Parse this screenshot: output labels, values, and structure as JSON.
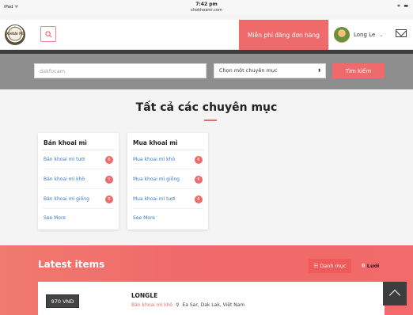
{
  "status_bar": {
    "device": "iPad ᯤ",
    "time": "7:42 pm",
    "url": "chokhoami.com",
    "indicators": "∗ ▬"
  },
  "header": {
    "logo_text": "KHOAI MÌ",
    "search_icon": "search-icon",
    "post_free_label": "Miễn phí đăng đơn hàng",
    "user_name": "Long Le",
    "caret": "⌄",
    "mail_icon": "mail-icon"
  },
  "search": {
    "keyword_value": "dakfocam",
    "category_select": "Chọn một chuyên mục",
    "select_arrow": "⬍",
    "submit_label": "Tìm kiếm"
  },
  "categories": {
    "title": "Tất cả các chuyên mục",
    "cards": [
      {
        "title": "Bán khoai mì",
        "items": [
          {
            "label": "Bán khoai mì tươi",
            "count": "6"
          },
          {
            "label": "Bán khoai mì khô",
            "count": "1"
          },
          {
            "label": "Bán khoai mì giống",
            "count": "6"
          }
        ],
        "see_more": "See More"
      },
      {
        "title": "Mua khoai mì",
        "items": [
          {
            "label": "Mua khoai mì khô",
            "count": "6"
          },
          {
            "label": "Mua khoai mì giống",
            "count": "6"
          },
          {
            "label": "Mua khoai mì tươi",
            "count": "6"
          }
        ],
        "see_more": "See More"
      }
    ]
  },
  "latest": {
    "title": "Latest items",
    "view_list_label": "Danh mục",
    "view_grid_label": "Lưới",
    "list_icon": "☰",
    "grid_icon": "⠿",
    "item": {
      "price": "970 VND",
      "name": "LONGLE",
      "category": "Bán khoai mì khô",
      "pin": "⚲",
      "location": "Ea Sar, Dak Lak, Việt Nam"
    }
  },
  "colors": {
    "accent": "#ef6a6a",
    "link": "#3a78c8",
    "dark": "#3d3d3d",
    "search_band": "#8e8e8e"
  }
}
